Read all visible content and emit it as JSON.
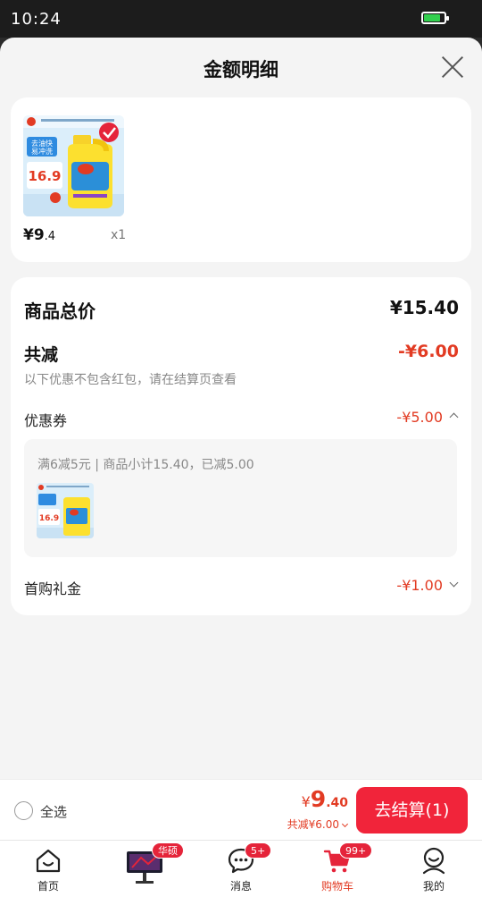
{
  "status_bar": {
    "time": "10:24",
    "battery_level": 0.8
  },
  "sheet": {
    "title": "金额明细"
  },
  "product": {
    "price_int": "¥9",
    "price_dec": ".4",
    "quantity": "x1",
    "image_text": {
      "line1": "去油快",
      "line2": "易冲洗",
      "price": "16.9"
    }
  },
  "detail": {
    "total_label": "商品总价",
    "total_value": "¥15.40",
    "reduce_label": "共减",
    "reduce_value": "-¥6.00",
    "note": "以下优惠不包含红包，请在结算页查看",
    "coupon_label": "优惠券",
    "coupon_value": "-¥5.00",
    "coupon_desc": "满6减5元 | 商品小计15.40，已减5.00",
    "first_label": "首购礼金",
    "first_value": "-¥1.00"
  },
  "checkout": {
    "select_all": "全选",
    "currency": "¥",
    "price_int": "9",
    "price_dec": ".40",
    "reduce": "共减¥6.00",
    "button": "去结算(1)"
  },
  "tabs": [
    {
      "label": "首页",
      "icon": "home-icon"
    },
    {
      "label": "",
      "icon": "monitor-product-icon",
      "badge": "华硕"
    },
    {
      "label": "消息",
      "icon": "message-icon",
      "badge": "5+"
    },
    {
      "label": "购物车",
      "icon": "cart-icon",
      "badge": "99+",
      "active": true
    },
    {
      "label": "我的",
      "icon": "profile-icon"
    }
  ],
  "colors": {
    "accent": "#e23b23",
    "button": "#f1243a",
    "badge": "#e5243a"
  }
}
